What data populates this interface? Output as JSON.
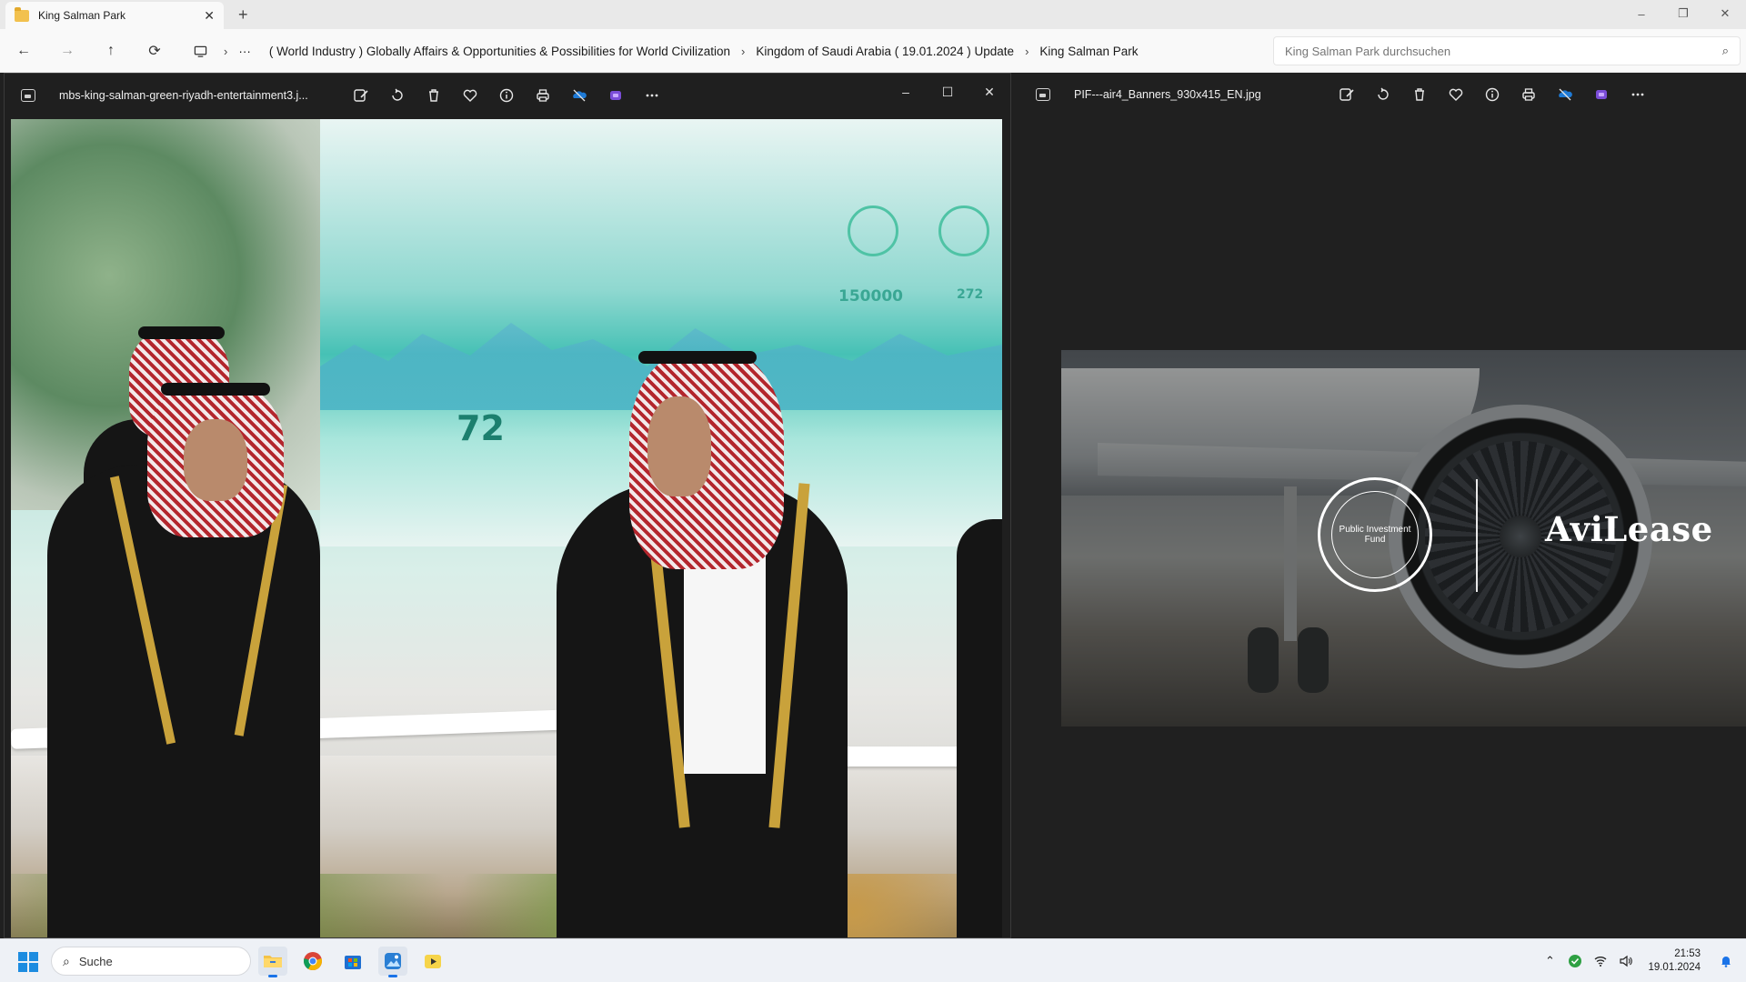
{
  "explorer": {
    "tab_title": "King Salman Park",
    "new_tab": "+",
    "window_controls": {
      "minimize": "–",
      "maximize": "❐",
      "close": "✕"
    },
    "nav": {
      "back": "←",
      "forward": "→",
      "up": "↑",
      "refresh": "⟳",
      "more": "···"
    },
    "breadcrumbs": [
      "( World Industry ) Globally Affairs & Opportunities & Possibilities for World Civilization",
      "Kingdom of Saudi Arabia ( 19.01.2024 ) Update",
      "King Salman Park"
    ],
    "search_placeholder": "King Salman Park durchsuchen"
  },
  "viewer_left": {
    "filename": "mbs-king-salman-green-riyadh-entertainment3.j...",
    "window_controls": {
      "minimize": "–",
      "maximize": "☐",
      "close": "✕"
    },
    "image": {
      "screen_numbers": [
        "150000",
        "272",
        "72"
      ]
    }
  },
  "viewer_right": {
    "filename": "PIF---air4_Banners_930x415_EN.jpg",
    "image": {
      "brand": "AviLease",
      "seal_text": "Public Investment Fund"
    }
  },
  "toolbar_icons": [
    "edit-icon",
    "rotate-icon",
    "delete-icon",
    "favorite-icon",
    "info-icon",
    "print-icon",
    "onedrive-icon",
    "clipchamp-icon",
    "more-icon"
  ],
  "taskbar": {
    "search_label": "Suche",
    "apps": [
      "file-explorer",
      "chrome",
      "microsoft-store",
      "photos",
      "player"
    ],
    "time": "21:53",
    "date": "19.01.2024"
  },
  "colors": {
    "viewer_bg": "#202020",
    "explorer_bg": "#f3f3f3",
    "taskbar_bg": "#eef1f6",
    "accent": "#1a73e8"
  }
}
